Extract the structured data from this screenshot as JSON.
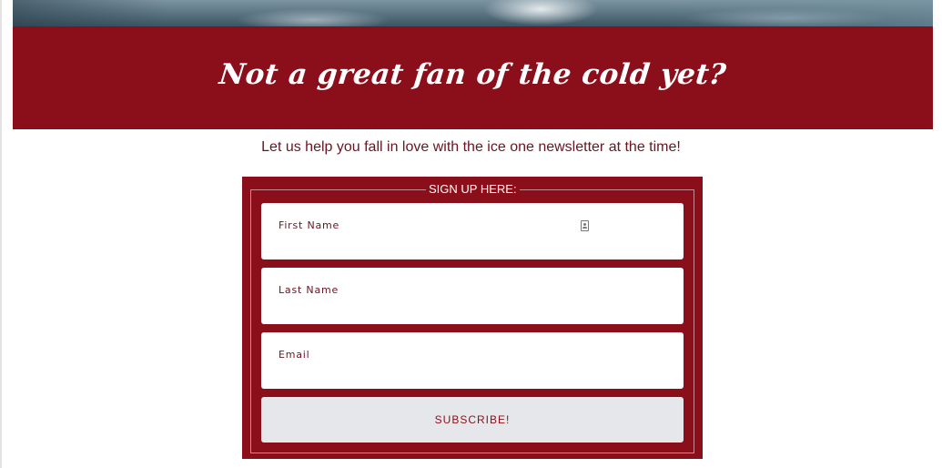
{
  "banner": {
    "title": "Not a great fan of the cold yet?",
    "background_color": "#8b0f1a"
  },
  "tagline": "Let us help you fall in love with the ice one newsletter at the time!",
  "signup_form": {
    "legend": "SIGN UP HERE:",
    "fields": {
      "first_name": {
        "label": "First Name",
        "value": ""
      },
      "last_name": {
        "label": "Last Name",
        "value": ""
      },
      "email": {
        "label": "Email",
        "value": ""
      }
    },
    "subscribe_label": "SUBSCRIBE!",
    "autofill_icon": "contact-card-icon"
  },
  "colors": {
    "accent": "#8b0f1a",
    "text": "#6a1420",
    "button_bg": "#e6e7ea"
  }
}
